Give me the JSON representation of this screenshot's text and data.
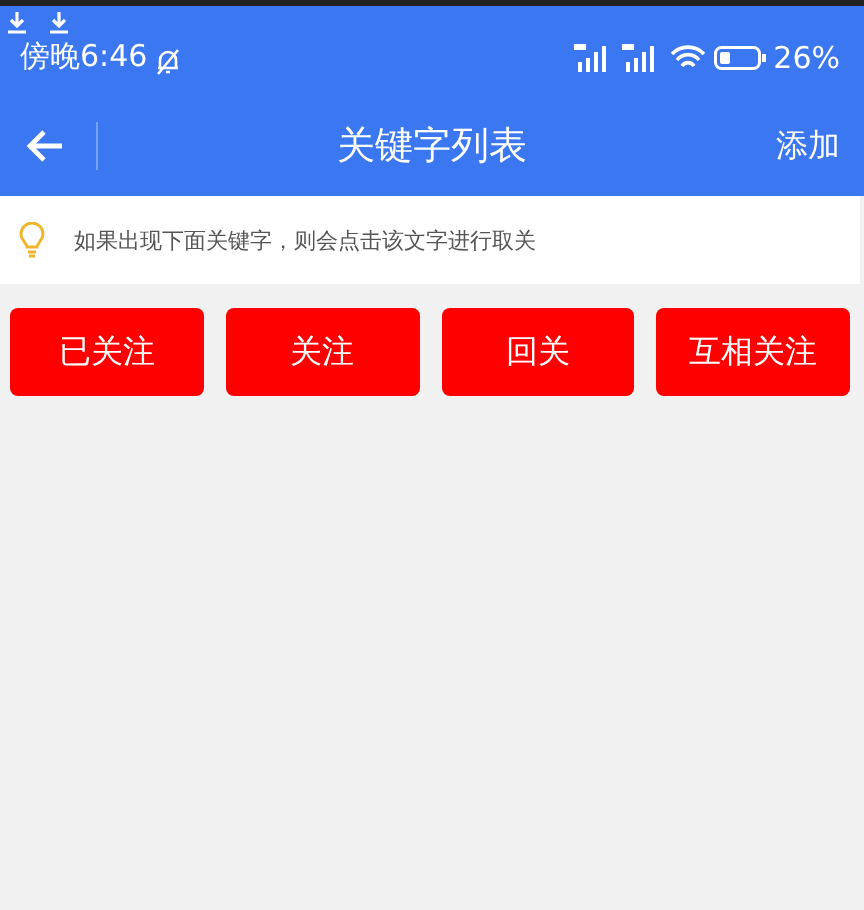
{
  "status_bar": {
    "time": "傍晚6:46",
    "battery": "26%"
  },
  "toolbar": {
    "title": "关键字列表",
    "action": "添加"
  },
  "tip": {
    "text": "如果出现下面关键字，则会点击该文字进行取关"
  },
  "keywords": [
    {
      "label": "已关注"
    },
    {
      "label": "关注"
    },
    {
      "label": "回关"
    },
    {
      "label": "互相关注"
    }
  ]
}
